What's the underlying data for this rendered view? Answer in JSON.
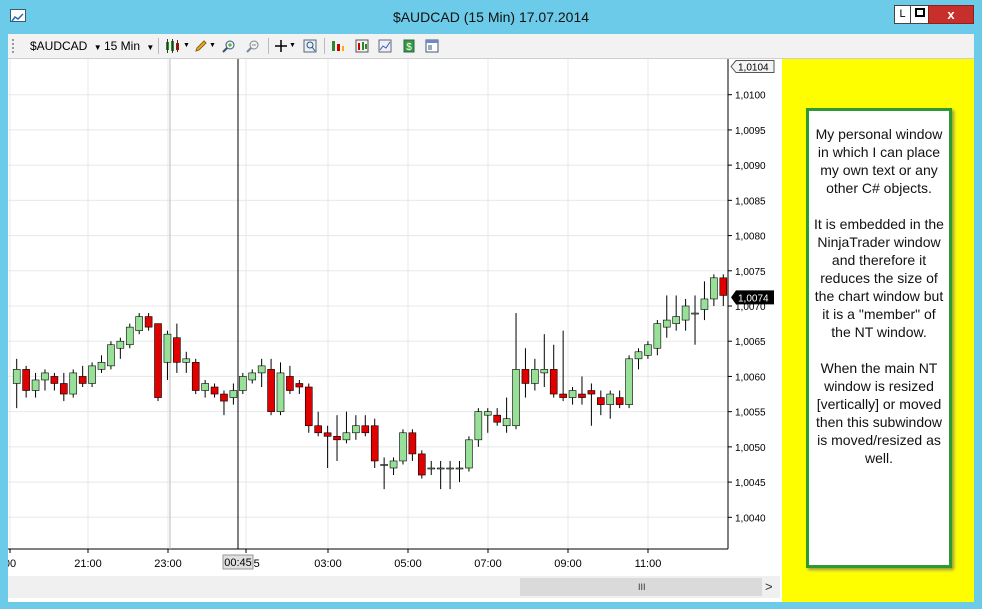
{
  "window": {
    "title": "$AUDCAD (15 Min)  17.07.2014"
  },
  "window_buttons": {
    "l_label": "L",
    "max_label": "",
    "close_label": "x"
  },
  "toolbar": {
    "instrument": "$AUDCAD",
    "interval": "15 Min",
    "icons": [
      "bar-style-icon",
      "pencil-icon",
      "zoom-in-icon",
      "zoom-out-icon",
      "crosshair-icon",
      "magnifier-icon",
      "indicators-icon",
      "strategies-icon",
      "chart-properties-icon",
      "data-box-icon",
      "panel-icon"
    ]
  },
  "chart_data": {
    "type": "candlestick",
    "instrument": "$AUDCAD",
    "interval": "15 Min",
    "x_tick_labels": [
      "00",
      "21:00",
      "23:00",
      "00:45",
      "03:00",
      "05:00",
      "07:00",
      "09:00",
      "11:00"
    ],
    "y_tick_labels": [
      "1,0040",
      "1,0045",
      "1,0050",
      "1,0055",
      "1,0060",
      "1,0065",
      "1,0070",
      "1,0075",
      "1,0080",
      "1,0085",
      "1,0090",
      "1,0095",
      "1,0100"
    ],
    "ylim": [
      1.00355,
      1.01045
    ],
    "top_price_label": "1,0104",
    "current_price_label": "1,0074",
    "grid": true,
    "bull_color": "#98e098",
    "bear_color": "#e00000",
    "candles": [
      {
        "o": 1.0059,
        "h": 1.00625,
        "l": 1.00555,
        "c": 1.0061
      },
      {
        "o": 1.0061,
        "h": 1.00615,
        "l": 1.0057,
        "c": 1.0058
      },
      {
        "o": 1.0058,
        "h": 1.00605,
        "l": 1.0057,
        "c": 1.00595
      },
      {
        "o": 1.00595,
        "h": 1.0061,
        "l": 1.0058,
        "c": 1.00605
      },
      {
        "o": 1.006,
        "h": 1.00605,
        "l": 1.0058,
        "c": 1.0059
      },
      {
        "o": 1.0059,
        "h": 1.00605,
        "l": 1.00565,
        "c": 1.00575
      },
      {
        "o": 1.00575,
        "h": 1.0061,
        "l": 1.0057,
        "c": 1.00605
      },
      {
        "o": 1.006,
        "h": 1.00615,
        "l": 1.00585,
        "c": 1.0059
      },
      {
        "o": 1.0059,
        "h": 1.0062,
        "l": 1.00585,
        "c": 1.00615
      },
      {
        "o": 1.0061,
        "h": 1.0063,
        "l": 1.00605,
        "c": 1.0062
      },
      {
        "o": 1.00615,
        "h": 1.0065,
        "l": 1.0061,
        "c": 1.00645
      },
      {
        "o": 1.0064,
        "h": 1.00655,
        "l": 1.00625,
        "c": 1.0065
      },
      {
        "o": 1.00645,
        "h": 1.00675,
        "l": 1.0064,
        "c": 1.0067
      },
      {
        "o": 1.00665,
        "h": 1.0069,
        "l": 1.0066,
        "c": 1.00685
      },
      {
        "o": 1.00685,
        "h": 1.0069,
        "l": 1.00665,
        "c": 1.0067
      },
      {
        "o": 1.00675,
        "h": 1.00675,
        "l": 1.00565,
        "c": 1.0057
      },
      {
        "o": 1.0062,
        "h": 1.00665,
        "l": 1.00595,
        "c": 1.0066
      },
      {
        "o": 1.00655,
        "h": 1.00675,
        "l": 1.00605,
        "c": 1.0062
      },
      {
        "o": 1.0062,
        "h": 1.00635,
        "l": 1.00605,
        "c": 1.00625
      },
      {
        "o": 1.0062,
        "h": 1.00625,
        "l": 1.00575,
        "c": 1.0058
      },
      {
        "o": 1.0058,
        "h": 1.00595,
        "l": 1.0057,
        "c": 1.0059
      },
      {
        "o": 1.00585,
        "h": 1.0059,
        "l": 1.0057,
        "c": 1.00575
      },
      {
        "o": 1.00575,
        "h": 1.0058,
        "l": 1.00545,
        "c": 1.00565
      },
      {
        "o": 1.0057,
        "h": 1.0059,
        "l": 1.0056,
        "c": 1.0058
      },
      {
        "o": 1.0058,
        "h": 1.00605,
        "l": 1.00575,
        "c": 1.006
      },
      {
        "o": 1.00595,
        "h": 1.0061,
        "l": 1.0059,
        "c": 1.00605
      },
      {
        "o": 1.00605,
        "h": 1.00625,
        "l": 1.00585,
        "c": 1.00615
      },
      {
        "o": 1.0061,
        "h": 1.00625,
        "l": 1.00545,
        "c": 1.0055
      },
      {
        "o": 1.0055,
        "h": 1.0062,
        "l": 1.00545,
        "c": 1.00605
      },
      {
        "o": 1.006,
        "h": 1.00615,
        "l": 1.00575,
        "c": 1.0058
      },
      {
        "o": 1.0059,
        "h": 1.00595,
        "l": 1.00575,
        "c": 1.00585
      },
      {
        "o": 1.00585,
        "h": 1.0059,
        "l": 1.0052,
        "c": 1.0053
      },
      {
        "o": 1.0053,
        "h": 1.0055,
        "l": 1.00515,
        "c": 1.0052
      },
      {
        "o": 1.0052,
        "h": 1.0053,
        "l": 1.0047,
        "c": 1.00515
      },
      {
        "o": 1.00515,
        "h": 1.00545,
        "l": 1.0048,
        "c": 1.0051
      },
      {
        "o": 1.0051,
        "h": 1.0055,
        "l": 1.00505,
        "c": 1.0052
      },
      {
        "o": 1.0052,
        "h": 1.00545,
        "l": 1.0051,
        "c": 1.0053
      },
      {
        "o": 1.0053,
        "h": 1.00545,
        "l": 1.00515,
        "c": 1.0052
      },
      {
        "o": 1.0053,
        "h": 1.0054,
        "l": 1.0047,
        "c": 1.0048
      },
      {
        "o": 1.00475,
        "h": 1.00485,
        "l": 1.0044,
        "c": 1.00475
      },
      {
        "o": 1.0047,
        "h": 1.00485,
        "l": 1.0046,
        "c": 1.0048
      },
      {
        "o": 1.0048,
        "h": 1.00525,
        "l": 1.00475,
        "c": 1.0052
      },
      {
        "o": 1.0052,
        "h": 1.00525,
        "l": 1.0048,
        "c": 1.0049
      },
      {
        "o": 1.0049,
        "h": 1.00495,
        "l": 1.00455,
        "c": 1.0046
      },
      {
        "o": 1.0047,
        "h": 1.0048,
        "l": 1.0046,
        "c": 1.0047
      },
      {
        "o": 1.0047,
        "h": 1.0048,
        "l": 1.0044,
        "c": 1.0047
      },
      {
        "o": 1.0047,
        "h": 1.0048,
        "l": 1.0044,
        "c": 1.0047
      },
      {
        "o": 1.0047,
        "h": 1.0048,
        "l": 1.0045,
        "c": 1.0047
      },
      {
        "o": 1.0047,
        "h": 1.00515,
        "l": 1.00465,
        "c": 1.0051
      },
      {
        "o": 1.0051,
        "h": 1.00555,
        "l": 1.005,
        "c": 1.0055
      },
      {
        "o": 1.00545,
        "h": 1.00555,
        "l": 1.0052,
        "c": 1.0055
      },
      {
        "o": 1.00545,
        "h": 1.00555,
        "l": 1.0053,
        "c": 1.00535
      },
      {
        "o": 1.0053,
        "h": 1.0057,
        "l": 1.0052,
        "c": 1.0054
      },
      {
        "o": 1.0053,
        "h": 1.0069,
        "l": 1.00525,
        "c": 1.0061
      },
      {
        "o": 1.0061,
        "h": 1.0064,
        "l": 1.0057,
        "c": 1.0059
      },
      {
        "o": 1.0059,
        "h": 1.00625,
        "l": 1.0058,
        "c": 1.0061
      },
      {
        "o": 1.00605,
        "h": 1.0066,
        "l": 1.00585,
        "c": 1.0061
      },
      {
        "o": 1.0061,
        "h": 1.00645,
        "l": 1.0057,
        "c": 1.00575
      },
      {
        "o": 1.00575,
        "h": 1.00665,
        "l": 1.00565,
        "c": 1.0057
      },
      {
        "o": 1.0057,
        "h": 1.00585,
        "l": 1.0056,
        "c": 1.0058
      },
      {
        "o": 1.00575,
        "h": 1.006,
        "l": 1.0056,
        "c": 1.0057
      },
      {
        "o": 1.0058,
        "h": 1.0059,
        "l": 1.0053,
        "c": 1.00575
      },
      {
        "o": 1.0057,
        "h": 1.0058,
        "l": 1.00545,
        "c": 1.0056
      },
      {
        "o": 1.0056,
        "h": 1.0058,
        "l": 1.0054,
        "c": 1.00575
      },
      {
        "o": 1.0057,
        "h": 1.0058,
        "l": 1.00555,
        "c": 1.0056
      },
      {
        "o": 1.0056,
        "h": 1.0063,
        "l": 1.00555,
        "c": 1.00625
      },
      {
        "o": 1.00625,
        "h": 1.0064,
        "l": 1.0061,
        "c": 1.00635
      },
      {
        "o": 1.0063,
        "h": 1.0065,
        "l": 1.00625,
        "c": 1.00645
      },
      {
        "o": 1.0064,
        "h": 1.0068,
        "l": 1.0063,
        "c": 1.00675
      },
      {
        "o": 1.0067,
        "h": 1.00715,
        "l": 1.00655,
        "c": 1.0068
      },
      {
        "o": 1.00675,
        "h": 1.00715,
        "l": 1.00665,
        "c": 1.00685
      },
      {
        "o": 1.0068,
        "h": 1.0071,
        "l": 1.00665,
        "c": 1.007
      },
      {
        "o": 1.0069,
        "h": 1.00715,
        "l": 1.00645,
        "c": 1.0069
      },
      {
        "o": 1.00695,
        "h": 1.00735,
        "l": 1.0068,
        "c": 1.0071
      },
      {
        "o": 1.0071,
        "h": 1.00745,
        "l": 1.007,
        "c": 1.0074
      },
      {
        "o": 1.0074,
        "h": 1.00745,
        "l": 1.007,
        "c": 1.00715
      }
    ]
  },
  "side_panel": {
    "text": "My personal window in which I can place my own text or any other C# objects.\n\nIt is embedded in the NinjaTrader window and therefore it reduces the size of the chart window but it is a \"member\" of the NT window.\n\nWhen the main NT window is resized [vertically] or moved then this subwindow is moved/resized as well."
  },
  "scrollbar": {
    "grip": "III",
    "right_arrow": ">"
  }
}
